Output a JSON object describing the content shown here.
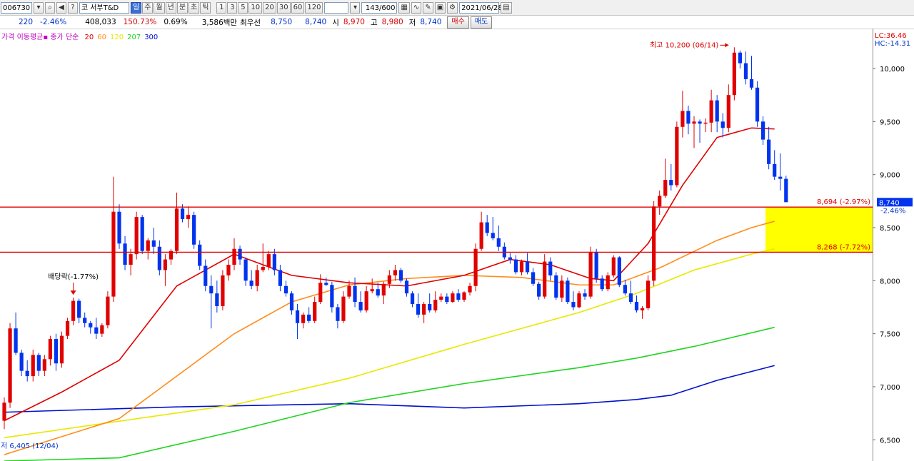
{
  "toolbar": {
    "code": "006730",
    "market_prefix": "코",
    "stock_name": "서부T&D",
    "periods": [
      "일",
      "주",
      "월",
      "년",
      "분",
      "초",
      "틱"
    ],
    "active_period": "일",
    "intervals": [
      "1",
      "3",
      "5",
      "10",
      "20",
      "30",
      "60",
      "120"
    ],
    "count": "143/600",
    "date": "2021/06/28"
  },
  "quote": {
    "change": "220",
    "change_pct": "-2.46%",
    "volume": "408,033",
    "volume_ratio": "150.73%",
    "turnover_pct": "0.69%",
    "amount": "3,586백만",
    "bid_label": "최우선",
    "bid": "8,750",
    "ask": "8,740",
    "open_label": "시",
    "open": "8,970",
    "high_label": "고",
    "high": "8,980",
    "low_label": "저",
    "low": "8,740",
    "buy_label": "매수",
    "sell_label": "매도"
  },
  "legend": {
    "title": "가격 이동평균",
    "mode": "종가 단순",
    "periods": [
      "20",
      "60",
      "120",
      "207",
      "300"
    ],
    "colors": [
      "#e00000",
      "#ff8c1a",
      "#e8e800",
      "#1fd41f",
      "#0011cc"
    ]
  },
  "chart_data": {
    "type": "candlestick",
    "ylim": [
      6300,
      10350
    ],
    "yticks": [
      "10,000",
      "9,500",
      "9,000",
      "8,500",
      "8,000",
      "7,500",
      "7,000",
      "6,500"
    ],
    "up_color": "#e00000",
    "down_color": "#0033ee",
    "candles": [
      [
        6680,
        6900,
        6600,
        6850
      ],
      [
        6850,
        7600,
        6800,
        7550
      ],
      [
        7550,
        7700,
        7300,
        7320
      ],
      [
        7320,
        7350,
        7100,
        7150
      ],
      [
        7150,
        7250,
        7050,
        7100
      ],
      [
        7100,
        7350,
        7050,
        7300
      ],
      [
        7300,
        7320,
        7100,
        7150
      ],
      [
        7150,
        7300,
        7100,
        7260
      ],
      [
        7260,
        7480,
        7200,
        7450
      ],
      [
        7450,
        7500,
        7150,
        7220
      ],
      [
        7220,
        7520,
        7180,
        7480
      ],
      [
        7480,
        7650,
        7450,
        7620
      ],
      [
        7620,
        7840,
        7580,
        7810
      ],
      [
        7810,
        7830,
        7600,
        7650
      ],
      [
        7650,
        7700,
        7560,
        7600
      ],
      [
        7600,
        7620,
        7500,
        7560
      ],
      [
        7560,
        7650,
        7450,
        7500
      ],
      [
        7500,
        7600,
        7470,
        7580
      ],
      [
        7580,
        7900,
        7550,
        7850
      ],
      [
        7850,
        8980,
        7800,
        8650
      ],
      [
        8650,
        8720,
        8300,
        8350
      ],
      [
        8350,
        8420,
        8100,
        8150
      ],
      [
        8150,
        8300,
        8050,
        8250
      ],
      [
        8250,
        8650,
        8200,
        8600
      ],
      [
        8600,
        8620,
        8250,
        8280
      ],
      [
        8280,
        8400,
        8200,
        8380
      ],
      [
        8380,
        8500,
        8250,
        8320
      ],
      [
        8320,
        8380,
        8050,
        8100
      ],
      [
        8100,
        8250,
        7950,
        8200
      ],
      [
        8200,
        8300,
        8150,
        8280
      ],
      [
        8280,
        8830,
        8250,
        8680
      ],
      [
        8680,
        8720,
        8550,
        8580
      ],
      [
        8580,
        8700,
        8500,
        8620
      ],
      [
        8620,
        8650,
        8300,
        8340
      ],
      [
        8340,
        8380,
        8100,
        8140
      ],
      [
        8140,
        8200,
        7900,
        7950
      ],
      [
        7950,
        8050,
        7550,
        7880
      ],
      [
        7880,
        8000,
        7700,
        7760
      ],
      [
        7760,
        8100,
        7720,
        8050
      ],
      [
        8050,
        8200,
        8000,
        8150
      ],
      [
        8150,
        8400,
        8100,
        8300
      ],
      [
        8300,
        8330,
        8150,
        8200
      ],
      [
        8200,
        8220,
        7950,
        8000
      ],
      [
        8000,
        8100,
        7920,
        7950
      ],
      [
        7950,
        8150,
        7900,
        8100
      ],
      [
        8100,
        8350,
        8080,
        8130
      ],
      [
        8130,
        8280,
        8100,
        8250
      ],
      [
        8250,
        8300,
        8050,
        8100
      ],
      [
        8100,
        8150,
        7900,
        7950
      ],
      [
        7950,
        8000,
        7850,
        7880
      ],
      [
        7880,
        7900,
        7680,
        7720
      ],
      [
        7720,
        7780,
        7450,
        7600
      ],
      [
        7600,
        7700,
        7550,
        7680
      ],
      [
        7680,
        7750,
        7600,
        7620
      ],
      [
        7620,
        7850,
        7600,
        7800
      ],
      [
        7800,
        8060,
        7780,
        7980
      ],
      [
        7980,
        8030,
        7950,
        7960
      ],
      [
        7960,
        7990,
        7700,
        7750
      ],
      [
        7750,
        7780,
        7550,
        7620
      ],
      [
        7620,
        7900,
        7600,
        7850
      ],
      [
        7850,
        8000,
        7830,
        7950
      ],
      [
        7950,
        8030,
        7750,
        7800
      ],
      [
        7800,
        7900,
        7700,
        7720
      ],
      [
        7720,
        7950,
        7700,
        7900
      ],
      [
        7900,
        8020,
        7880,
        7920
      ],
      [
        7920,
        7980,
        7840,
        7860
      ],
      [
        7860,
        7990,
        7780,
        7970
      ],
      [
        7970,
        8100,
        7930,
        8050
      ],
      [
        8050,
        8150,
        8000,
        8100
      ],
      [
        8100,
        8120,
        7980,
        8000
      ],
      [
        8000,
        8020,
        7850,
        7880
      ],
      [
        7880,
        7900,
        7750,
        7780
      ],
      [
        7780,
        7880,
        7650,
        7680
      ],
      [
        7680,
        7800,
        7600,
        7780
      ],
      [
        7780,
        7880,
        7700,
        7720
      ],
      [
        7720,
        7900,
        7700,
        7820
      ],
      [
        7820,
        7880,
        7800,
        7850
      ],
      [
        7850,
        7880,
        7780,
        7800
      ],
      [
        7800,
        7900,
        7790,
        7880
      ],
      [
        7880,
        7920,
        7800,
        7820
      ],
      [
        7820,
        7900,
        7800,
        7890
      ],
      [
        7890,
        7980,
        7860,
        7950
      ],
      [
        7950,
        8350,
        7900,
        8300
      ],
      [
        8300,
        8650,
        8280,
        8550
      ],
      [
        8550,
        8620,
        8420,
        8450
      ],
      [
        8450,
        8600,
        8380,
        8400
      ],
      [
        8400,
        8520,
        8280,
        8320
      ],
      [
        8320,
        8360,
        8200,
        8220
      ],
      [
        8220,
        8260,
        8160,
        8200
      ],
      [
        8200,
        8240,
        8060,
        8080
      ],
      [
        8080,
        8200,
        8050,
        8180
      ],
      [
        8180,
        8260,
        8060,
        8080
      ],
      [
        8080,
        8120,
        7950,
        7970
      ],
      [
        7970,
        7990,
        7820,
        7850
      ],
      [
        7850,
        8250,
        7830,
        8180
      ],
      [
        8180,
        8220,
        8000,
        8050
      ],
      [
        8050,
        8080,
        7820,
        7840
      ],
      [
        7840,
        8050,
        7800,
        8000
      ],
      [
        8000,
        8030,
        7780,
        7800
      ],
      [
        7800,
        7900,
        7720,
        7750
      ],
      [
        7750,
        7900,
        7740,
        7880
      ],
      [
        7880,
        7920,
        7820,
        7850
      ],
      [
        7850,
        8320,
        7830,
        8270
      ],
      [
        8270,
        8300,
        7980,
        8020
      ],
      [
        8020,
        8050,
        7900,
        7920
      ],
      [
        7920,
        8080,
        7900,
        8050
      ],
      [
        8050,
        8240,
        8030,
        8220
      ],
      [
        8220,
        8230,
        7940,
        7960
      ],
      [
        7960,
        8010,
        7860,
        7880
      ],
      [
        7880,
        8000,
        7780,
        7800
      ],
      [
        7800,
        7860,
        7700,
        7720
      ],
      [
        7720,
        7760,
        7640,
        7740
      ],
      [
        7740,
        8050,
        7720,
        8000
      ],
      [
        8000,
        8750,
        7950,
        8700
      ],
      [
        8700,
        8850,
        8620,
        8800
      ],
      [
        8800,
        9150,
        8780,
        8950
      ],
      [
        8950,
        9100,
        8850,
        8900
      ],
      [
        8900,
        9500,
        8880,
        9450
      ],
      [
        9450,
        9790,
        9350,
        9600
      ],
      [
        9600,
        9650,
        9380,
        9480
      ],
      [
        9480,
        9550,
        9250,
        9500
      ],
      [
        9500,
        9520,
        9300,
        9480
      ],
      [
        9480,
        9530,
        9400,
        9490
      ],
      [
        9490,
        9800,
        9400,
        9700
      ],
      [
        9700,
        9750,
        9400,
        9500
      ],
      [
        9500,
        9580,
        9350,
        9440
      ],
      [
        9440,
        9850,
        9400,
        9750
      ],
      [
        9750,
        10200,
        9700,
        10150
      ],
      [
        10150,
        10170,
        10000,
        10050
      ],
      [
        10050,
        10160,
        9850,
        9900
      ],
      [
        9900,
        10120,
        9800,
        9820
      ],
      [
        9820,
        9880,
        9450,
        9500
      ],
      [
        9500,
        9550,
        9280,
        9330
      ],
      [
        9330,
        9450,
        9050,
        9100
      ],
      [
        9100,
        9230,
        8950,
        8980
      ],
      [
        8980,
        9200,
        8850,
        8960
      ],
      [
        8960,
        8990,
        8850,
        8740
      ]
    ],
    "moving_averages": {
      "ma20": [
        [
          0,
          6680
        ],
        [
          10,
          6950
        ],
        [
          20,
          7250
        ],
        [
          30,
          7950
        ],
        [
          40,
          8250
        ],
        [
          50,
          8050
        ],
        [
          60,
          7980
        ],
        [
          70,
          7950
        ],
        [
          80,
          8050
        ],
        [
          88,
          8200
        ],
        [
          95,
          8150
        ],
        [
          102,
          8020
        ],
        [
          106,
          8000
        ],
        [
          112,
          8350
        ],
        [
          118,
          8900
        ],
        [
          124,
          9350
        ],
        [
          130,
          9440
        ],
        [
          134,
          9430
        ]
      ],
      "ma60": [
        [
          0,
          6360
        ],
        [
          20,
          6700
        ],
        [
          40,
          7500
        ],
        [
          50,
          7800
        ],
        [
          60,
          7960
        ],
        [
          70,
          8020
        ],
        [
          80,
          8050
        ],
        [
          90,
          8030
        ],
        [
          100,
          7960
        ],
        [
          106,
          7960
        ],
        [
          114,
          8120
        ],
        [
          124,
          8380
        ],
        [
          130,
          8500
        ],
        [
          134,
          8560
        ]
      ],
      "ma120": [
        [
          0,
          6520
        ],
        [
          40,
          6830
        ],
        [
          60,
          7080
        ],
        [
          80,
          7400
        ],
        [
          100,
          7700
        ],
        [
          110,
          7880
        ],
        [
          120,
          8100
        ],
        [
          130,
          8250
        ],
        [
          134,
          8300
        ]
      ],
      "ma207": [
        [
          0,
          6300
        ],
        [
          20,
          6330
        ],
        [
          40,
          6580
        ],
        [
          60,
          6850
        ],
        [
          80,
          7030
        ],
        [
          100,
          7180
        ],
        [
          110,
          7270
        ],
        [
          120,
          7380
        ],
        [
          134,
          7560
        ]
      ],
      "ma300": [
        [
          0,
          6760
        ],
        [
          30,
          6810
        ],
        [
          60,
          6840
        ],
        [
          80,
          6800
        ],
        [
          100,
          6840
        ],
        [
          110,
          6880
        ],
        [
          116,
          6920
        ],
        [
          124,
          7060
        ],
        [
          134,
          7200
        ]
      ]
    },
    "hlines": [
      {
        "value": 8694,
        "label": "8,694 (-2.97%)"
      },
      {
        "value": 8268,
        "label": "8,268 (-7.72%)"
      }
    ],
    "target_zone": [
      8268,
      8694
    ],
    "max_annotation": "최고 10,200 (06/14)",
    "min_annotation": "저 6,405 (12/04)",
    "dividend_annotation": "배당락(-1.77%)",
    "dividend_index": 12,
    "max_index": 127,
    "current_price": "8,740",
    "current_price_pct": "-2.46%",
    "lc_label": "LC:36.46",
    "hc_label": "HC:-14.31"
  }
}
